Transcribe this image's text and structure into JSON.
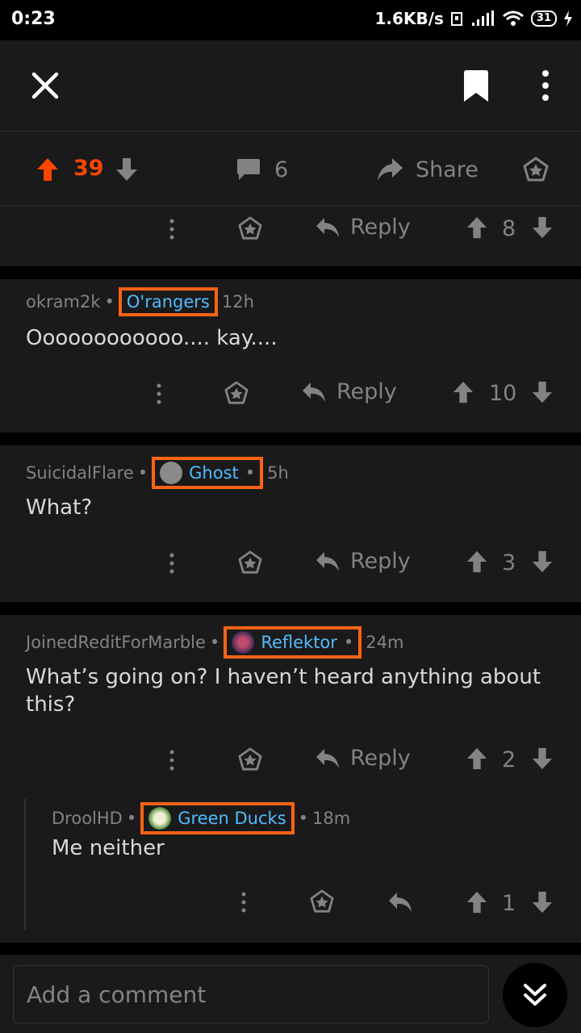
{
  "status_bar": {
    "time": "0:23",
    "speed": "1.6KB/s",
    "battery": "31"
  },
  "post_actions": {
    "score": "39",
    "comments": "6",
    "share": "Share"
  },
  "top_comment_actions": {
    "reply": "Reply",
    "score": "8"
  },
  "comments": [
    {
      "user": "okram2k",
      "flair": "O'rangers",
      "time": "12h",
      "body": "Oooooooooooo.... kay....",
      "reply": "Reply",
      "score": "10"
    },
    {
      "user": "SuicidalFlare",
      "flair": "Ghost",
      "time": "5h",
      "body": "What?",
      "reply": "Reply",
      "score": "3"
    },
    {
      "user": "JoinedReditForMarble",
      "flair": "Reflektor",
      "time": "24m",
      "body": "What’s going on? I haven’t heard anything about this?",
      "reply": "Reply",
      "score": "2"
    },
    {
      "user": "DroolHD",
      "flair": "Green Ducks",
      "time": "18m",
      "body": "Me neither",
      "score": "1"
    }
  ],
  "composer": {
    "placeholder": "Add a comment"
  },
  "colors": {
    "upvote": "#ff4500",
    "link": "#4fbcff",
    "flair_border": "#ff6314",
    "background": "#1a1a1b"
  }
}
